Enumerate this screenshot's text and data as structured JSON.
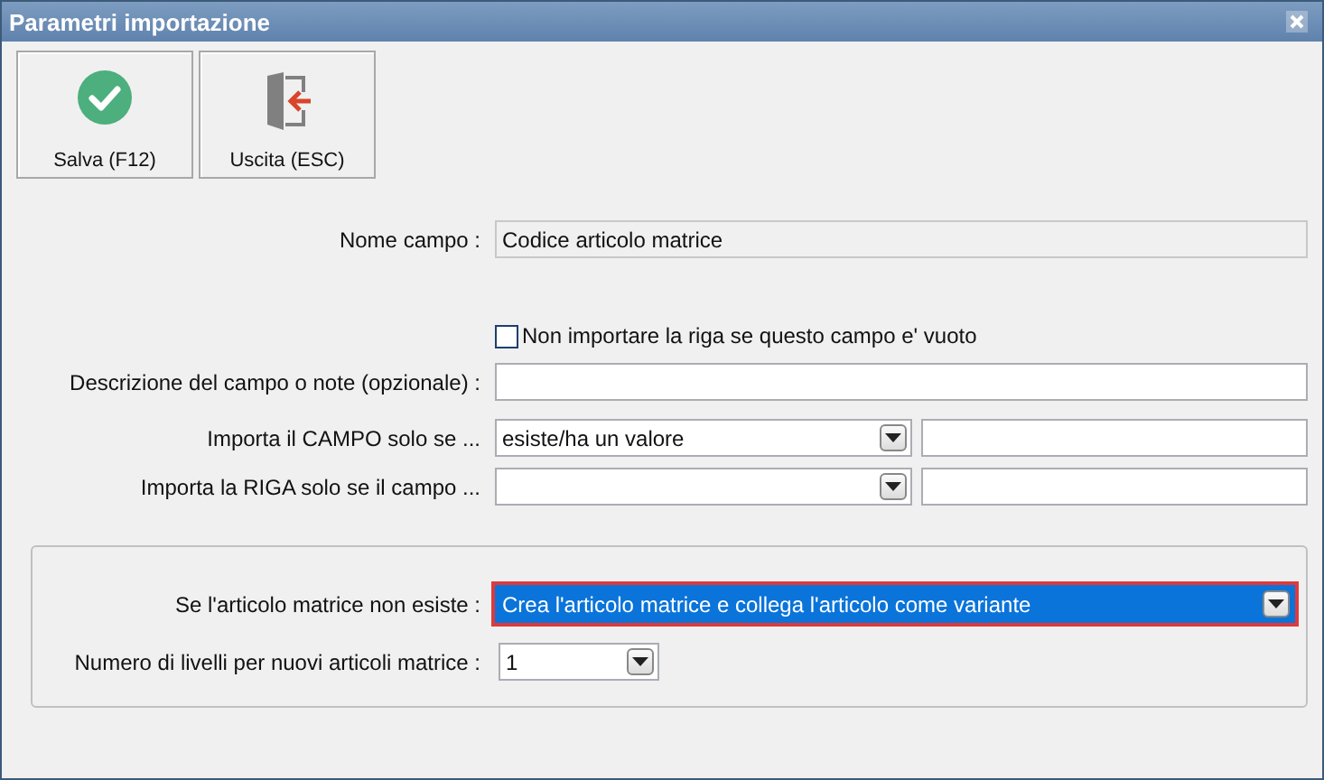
{
  "window": {
    "title": "Parametri importazione"
  },
  "toolbar": [
    {
      "label": "Salva (F12)",
      "kind": "save"
    },
    {
      "label": "Uscita (ESC)",
      "kind": "exit"
    }
  ],
  "form": [
    {
      "kind": "readonly",
      "label": "Nome campo :",
      "value": "Codice articolo matrice"
    },
    {
      "kind": "checkbox",
      "label": "Non importare la riga se questo campo e' vuoto",
      "checked": false
    },
    {
      "kind": "text",
      "label": "Descrizione del campo o note (opzionale) :"
    },
    {
      "kind": "combo_pair",
      "label": "Importa il CAMPO solo se ...",
      "value": "esiste/ha un valore"
    },
    {
      "kind": "combo_pair",
      "label": "Importa la RIGA solo se il campo ..."
    }
  ],
  "group": [
    {
      "label": "Se l'articolo matrice non esiste :",
      "value": "Crea l'articolo matrice e collega l'articolo come variante",
      "selected": true,
      "kind": "wide"
    },
    {
      "label": "Numero di livelli per nuovi articoli matrice :",
      "value": "1",
      "selected": false,
      "kind": "narrow"
    }
  ]
}
